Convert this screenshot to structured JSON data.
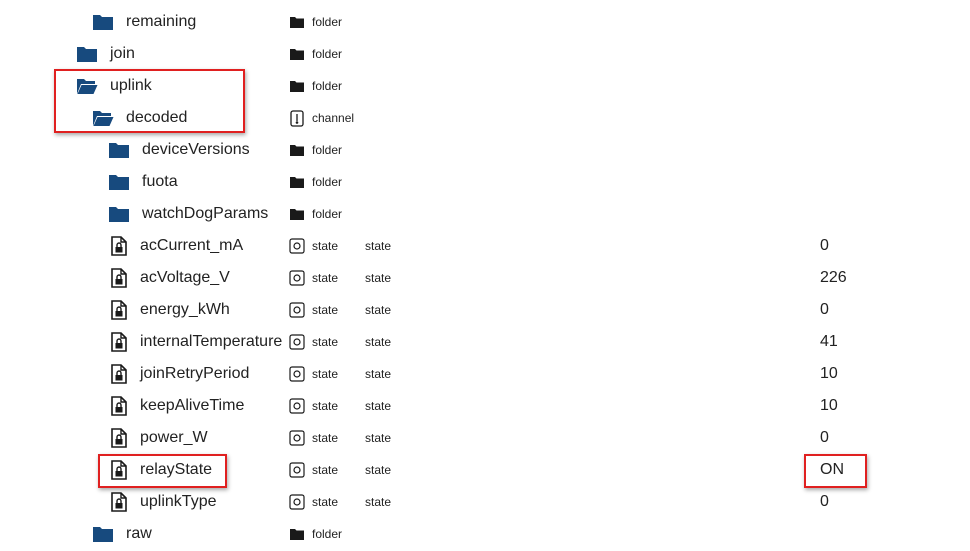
{
  "rows": [
    {
      "label": "remaining",
      "type": "folder",
      "icon": "folder-closed-icon"
    },
    {
      "label": "join",
      "type": "folder",
      "icon": "folder-closed-icon"
    },
    {
      "label": "uplink",
      "type": "folder",
      "icon": "folder-open-icon"
    },
    {
      "label": "decoded",
      "type": "channel",
      "icon": "folder-open-icon"
    },
    {
      "label": "deviceVersions",
      "type": "folder",
      "icon": "folder-closed-icon"
    },
    {
      "label": "fuota",
      "type": "folder",
      "icon": "folder-closed-icon"
    },
    {
      "label": "watchDogParams",
      "type": "folder",
      "icon": "folder-closed-icon"
    },
    {
      "label": "acCurrent_mA",
      "type": "state",
      "role": "state",
      "value": "0",
      "icon": "locked-file-icon"
    },
    {
      "label": "acVoltage_V",
      "type": "state",
      "role": "state",
      "value": "226",
      "icon": "locked-file-icon"
    },
    {
      "label": "energy_kWh",
      "type": "state",
      "role": "state",
      "value": "0",
      "icon": "locked-file-icon"
    },
    {
      "label": "internalTemperature",
      "type": "state",
      "role": "state",
      "value": "41",
      "icon": "locked-file-icon"
    },
    {
      "label": "joinRetryPeriod",
      "type": "state",
      "role": "state",
      "value": "10",
      "icon": "locked-file-icon"
    },
    {
      "label": "keepAliveTime",
      "type": "state",
      "role": "state",
      "value": "10",
      "icon": "locked-file-icon"
    },
    {
      "label": "power_W",
      "type": "state",
      "role": "state",
      "value": "0",
      "icon": "locked-file-icon"
    },
    {
      "label": "relayState",
      "type": "state",
      "role": "state",
      "value": "ON",
      "icon": "locked-file-icon"
    },
    {
      "label": "uplinkType",
      "type": "state",
      "role": "state",
      "value": "0",
      "icon": "locked-file-icon"
    },
    {
      "label": "raw",
      "type": "folder",
      "icon": "folder-closed-icon"
    }
  ],
  "colors": {
    "folder": "#174a7e",
    "highlight": "#e02020",
    "type_icon": "#1a1a1a"
  }
}
